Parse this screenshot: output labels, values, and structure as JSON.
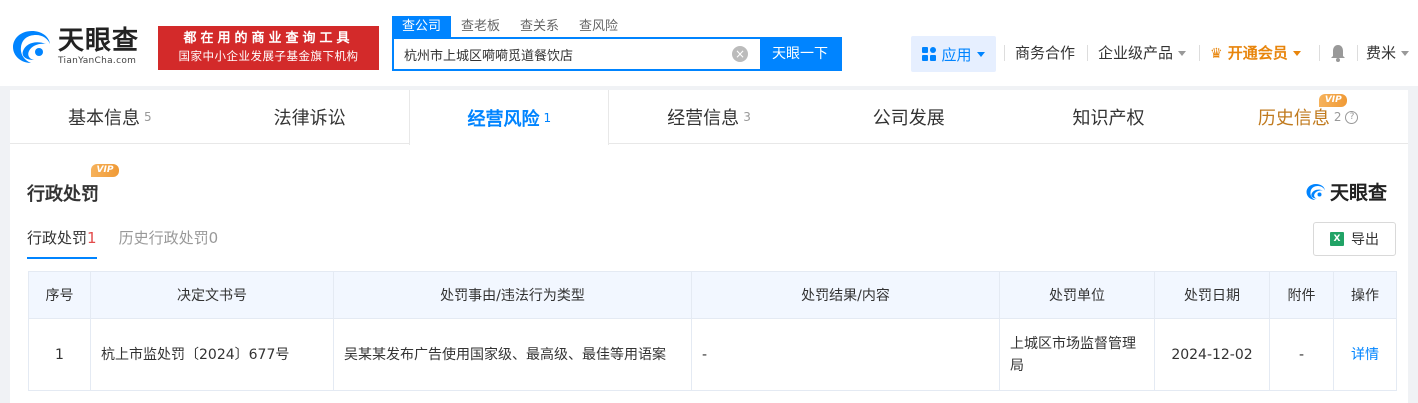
{
  "header": {
    "logo_cn": "天眼查",
    "logo_en": "TianYanCha.com",
    "slogan_line1": "都在用的商业查询工具",
    "slogan_line2": "国家中小企业发展子基金旗下机构",
    "search_tabs": [
      "查公司",
      "查老板",
      "查关系",
      "查风险"
    ],
    "search_value": "杭州市上城区嗬嗬觅道餐饮店",
    "search_button": "天眼一下",
    "apps_label": "应用",
    "nav": {
      "business": "商务合作",
      "enterprise": "企业级产品",
      "vip": "开通会员",
      "user": "费米"
    },
    "colors": {
      "brand_blue": "#0084ff",
      "slogan_red": "#d32a2a",
      "vip_orange": "#e8850c"
    }
  },
  "main_tabs": [
    {
      "label": "基本信息",
      "count": "5"
    },
    {
      "label": "法律诉讼",
      "count": ""
    },
    {
      "label": "经营风险",
      "count": "1"
    },
    {
      "label": "经营信息",
      "count": "3"
    },
    {
      "label": "公司发展",
      "count": ""
    },
    {
      "label": "知识产权",
      "count": ""
    },
    {
      "label": "历史信息",
      "count": "2"
    }
  ],
  "vip_badge": "VIP",
  "section": {
    "title": "行政处罚",
    "brand": "天眼查",
    "sub_tabs": [
      {
        "label": "行政处罚",
        "count": "1"
      },
      {
        "label": "历史行政处罚",
        "count": "0"
      }
    ],
    "export_label": "导出"
  },
  "table": {
    "headers": [
      "序号",
      "决定文书号",
      "处罚事由/违法行为类型",
      "处罚结果/内容",
      "处罚单位",
      "处罚日期",
      "附件",
      "操作"
    ],
    "rows": [
      {
        "index": "1",
        "doc_no": "杭上市监处罚〔2024〕677号",
        "reason": "吴某某发布广告使用国家级、最高级、最佳等用语案",
        "result": "-",
        "authority": "上城区市场监督管理局",
        "date": "2024-12-02",
        "attachment": "-",
        "action": "详情"
      }
    ]
  }
}
